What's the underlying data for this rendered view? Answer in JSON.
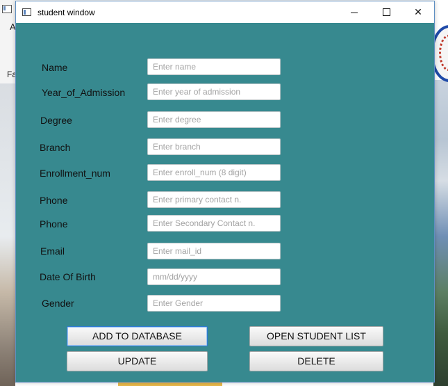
{
  "background": {
    "left_partial_text_1": "A",
    "left_partial_text_2": "Fa"
  },
  "window": {
    "title": "student window",
    "controls": {
      "minimize": "minimize",
      "maximize": "maximize",
      "close": "✕"
    },
    "accent_color": "#37898f"
  },
  "form": {
    "fields": [
      {
        "label": "Name",
        "placeholder": "Enter name",
        "value": ""
      },
      {
        "label": "Year_of_Admission",
        "placeholder": "Enter year of admission",
        "value": ""
      },
      {
        "label": "Degree",
        "placeholder": "Enter degree",
        "value": ""
      },
      {
        "label": "Branch",
        "placeholder": "Enter branch",
        "value": ""
      },
      {
        "label": "Enrollment_num",
        "placeholder": "Enter enroll_num (8 digit)",
        "value": ""
      },
      {
        "label": "Phone",
        "placeholder": "Enter primary contact n.",
        "value": ""
      },
      {
        "label": "Phone",
        "placeholder": "Enter Secondary Contact n.",
        "value": ""
      },
      {
        "label": "Email",
        "placeholder": "Enter mail_id",
        "value": ""
      },
      {
        "label": "Date Of Birth",
        "placeholder": "mm/dd/yyyy",
        "value": ""
      },
      {
        "label": "Gender",
        "placeholder": "Enter Gender",
        "value": ""
      }
    ]
  },
  "buttons": {
    "add": "ADD TO DATABASE",
    "open_list": "OPEN STUDENT LIST",
    "update": "UPDATE",
    "delete": "DELETE"
  }
}
